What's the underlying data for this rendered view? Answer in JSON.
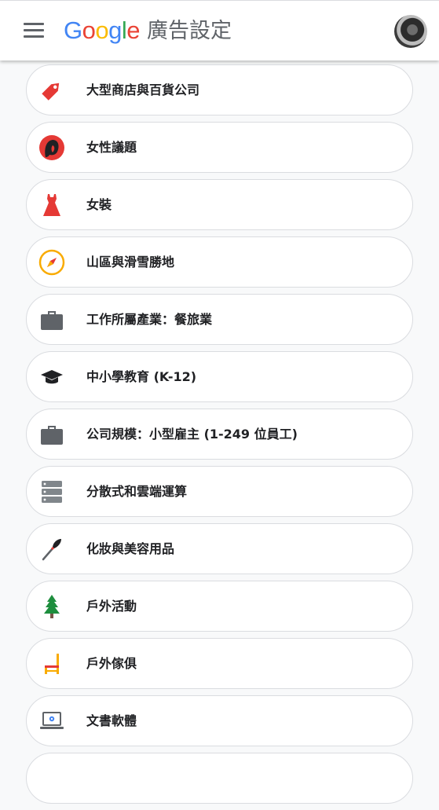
{
  "header": {
    "logo_letters": [
      "G",
      "o",
      "o",
      "g",
      "l",
      "e"
    ],
    "logo_colors": [
      "#4285F4",
      "#EA4335",
      "#FBBC05",
      "#4285F4",
      "#34A853",
      "#EA4335"
    ],
    "title": "廣告設定"
  },
  "topics": [
    {
      "label": "大型商店與百貨公司",
      "icon": "price-tag-icon"
    },
    {
      "label": "女性議題",
      "icon": "woman-silhouette-icon"
    },
    {
      "label": "女裝",
      "icon": "dress-icon"
    },
    {
      "label": "山區與滑雪勝地",
      "icon": "compass-icon"
    },
    {
      "label": "工作所屬產業：餐旅業",
      "icon": "briefcase-icon"
    },
    {
      "label": "中小學教育 (K-12)",
      "icon": "graduation-cap-icon"
    },
    {
      "label": "公司規模：小型雇主 (1-249 位員工)",
      "icon": "briefcase-icon"
    },
    {
      "label": "分散式和雲端運算",
      "icon": "server-rack-icon"
    },
    {
      "label": "化妝與美容用品",
      "icon": "makeup-brush-icon"
    },
    {
      "label": "戶外活動",
      "icon": "pine-tree-icon"
    },
    {
      "label": "戶外傢俱",
      "icon": "chair-icon"
    },
    {
      "label": "文書軟體",
      "icon": "laptop-icon"
    }
  ]
}
